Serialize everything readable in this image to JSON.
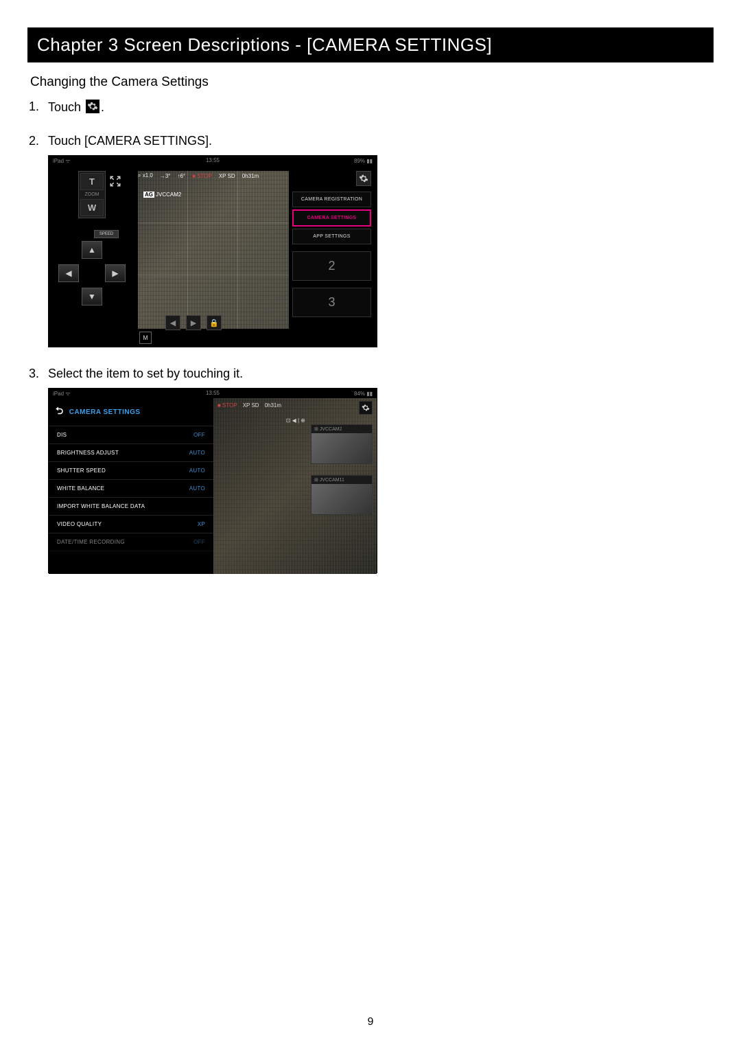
{
  "chapter_header": "Chapter 3    Screen Descriptions - [CAMERA SETTINGS]",
  "section_title": "Changing the Camera Settings",
  "steps": {
    "s1": "Touch ",
    "s1_tail": ".",
    "s2": "Touch [CAMERA SETTINGS].",
    "s3": "Select the item to set by touching it."
  },
  "page_number": "9",
  "screenshot1": {
    "status": {
      "left": "iPad ᯤ",
      "center": "13:55",
      "right": "89%  ▮▮"
    },
    "zoom": {
      "t": "T",
      "label": "ZOOM",
      "w": "W"
    },
    "speed": "SPEED",
    "cam_info": {
      "zoom": "⌕ x1.0",
      "dir": "→3°",
      "tilt": "↑6°",
      "stop": "■ STOP",
      "fmt": "XP SD",
      "time": "0h31m"
    },
    "camera_overlay": {
      "tag": "AG",
      "name": "JVCCAM2"
    },
    "menu": {
      "reg": "CAMERA REGISTRATION",
      "cam": "CAMERA SETTINGS",
      "app": "APP SETTINGS"
    },
    "presets": {
      "p2": "2",
      "p3": "3"
    },
    "m_icon": "M"
  },
  "screenshot2": {
    "status": {
      "left": "iPad ᯤ",
      "center": "13:55",
      "right": "84%  ▮▮"
    },
    "header": "CAMERA SETTINGS",
    "top": {
      "stop": "■ STOP",
      "fmt": "XP SD",
      "time": "0h31m"
    },
    "rows": [
      {
        "label": "DIS",
        "val": "OFF"
      },
      {
        "label": "BRIGHTNESS ADJUST",
        "val": "AUTO"
      },
      {
        "label": "SHUTTER SPEED",
        "val": "AUTO"
      },
      {
        "label": "WHITE BALANCE",
        "val": "AUTO"
      },
      {
        "label": "IMPORT WHITE BALANCE DATA",
        "val": ""
      },
      {
        "label": "VIDEO QUALITY",
        "val": "XP"
      },
      {
        "label": "DATE/TIME RECORDING",
        "val": "OFF"
      }
    ],
    "thumbs": {
      "t1": "⊞ JVCCAM2",
      "t2": "⊞ JVCCAM11"
    },
    "mini_overlay": "⊡ ◀ | ⊕"
  }
}
